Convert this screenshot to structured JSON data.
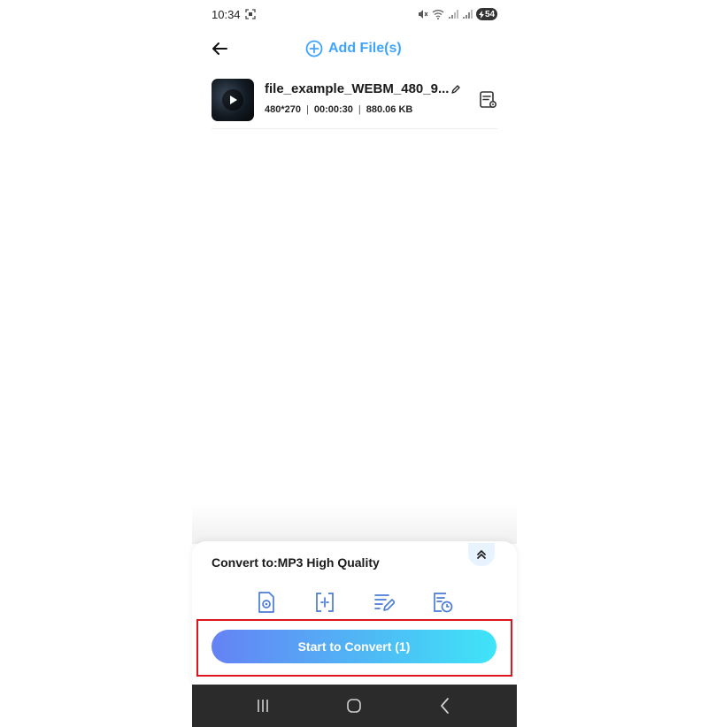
{
  "status_bar": {
    "time": "10:34",
    "battery": "54",
    "icons": [
      "screenshot-icon",
      "mute-icon",
      "wifi-icon",
      "signal-icon",
      "signal-icon",
      "battery-charging-icon"
    ]
  },
  "header": {
    "back_icon": "arrow-left-icon",
    "add_files_label": "Add File(s)",
    "add_icon": "plus-circle-icon"
  },
  "file": {
    "name": "file_example_WEBM_480_9...",
    "resolution": "480*270",
    "separator": "|",
    "duration": "00:00:30",
    "size": "880.06 KB"
  },
  "convert_panel": {
    "label": "Convert to:MP3 High Quality",
    "tools": [
      "format-settings-icon",
      "trim-icon",
      "rename-edit-icon",
      "schedule-icon"
    ],
    "start_button": "Start to Convert (1)"
  },
  "colors": {
    "accent": "#3fa4ff",
    "button_gradient_start": "#6582f5",
    "button_gradient_end": "#3fe4f8",
    "highlight_box": "#e0141e",
    "navbar": "#2b2b2b"
  },
  "nav_bar": [
    "recent-apps-icon",
    "home-icon",
    "back-nav-icon"
  ]
}
